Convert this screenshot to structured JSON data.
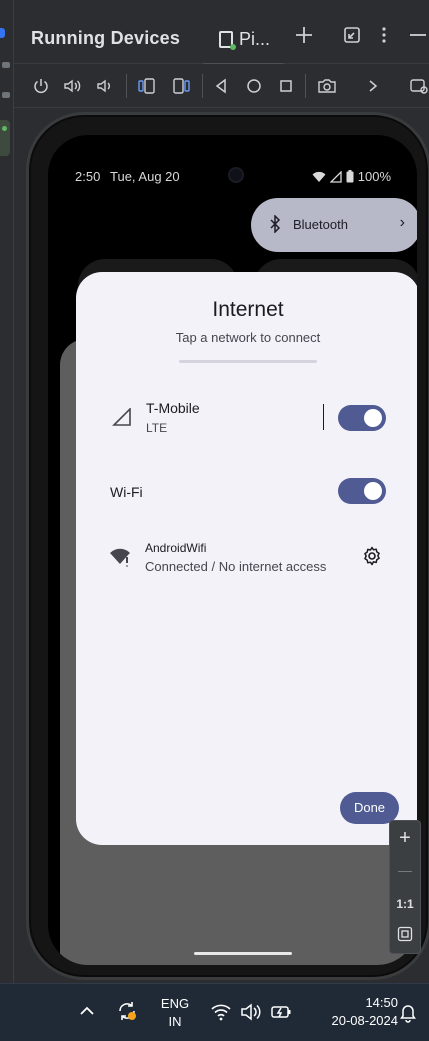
{
  "ide": {
    "panel_title": "Running Devices",
    "device_tab_label": "Pi...",
    "header_buttons": [
      "add-icon",
      "restore-icon",
      "more-vert-icon",
      "minimize-icon"
    ],
    "toolbar_buttons": [
      "power-icon",
      "volume-up-icon",
      "volume-down-icon",
      "rotate-left-icon",
      "rotate-right-icon",
      "back-icon",
      "home-icon",
      "overview-icon",
      "camera-icon",
      "chevron-right-icon",
      "window-icon"
    ]
  },
  "phone": {
    "status": {
      "time": "2:50",
      "date": "Tue, Aug 20",
      "battery": "100%"
    },
    "quick_settings": {
      "bluetooth_label": "Bluetooth"
    },
    "internet_dialog": {
      "title": "Internet",
      "subtitle": "Tap a network to connect",
      "mobile": {
        "name": "T-Mobile",
        "type": "LTE",
        "enabled": true
      },
      "wifi": {
        "label": "Wi-Fi",
        "enabled": true
      },
      "access_point": {
        "name": "AndroidWifi",
        "status": "Connected / No internet access"
      },
      "done_label": "Done"
    }
  },
  "zoom_controls": {
    "zoom_in": "+",
    "zoom_out": "—",
    "actual_size": "1:1"
  },
  "taskbar": {
    "lang_line1": "ENG",
    "lang_line2": "IN",
    "time": "14:50",
    "date": "20-08-2024"
  },
  "colors": {
    "accent": "#4f5b92",
    "dialog_bg": "#f4f2f9",
    "ide_bg": "#2b2d30",
    "taskbar_bg": "#1f2a36"
  }
}
